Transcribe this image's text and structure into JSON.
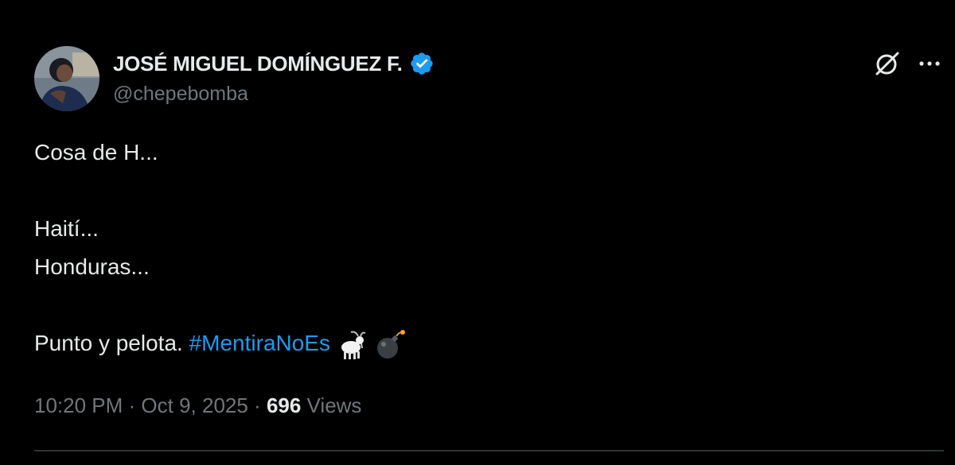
{
  "author": {
    "display_name": "JOSÉ MIGUEL DOMÍNGUEZ F.",
    "handle": "@chepebomba",
    "verified_icon": "verified-badge-icon",
    "verified_color": "#1d9bf0"
  },
  "header_actions": {
    "grok_icon": "grok-icon",
    "more_icon": "more-options-icon"
  },
  "tweet": {
    "line1": "Cosa de H...",
    "line2": "Haití...",
    "line3": "Honduras...",
    "line4_text": "Punto y pelota. ",
    "hashtag": "#MentiraNoEs",
    "emojis": [
      "goat-emoji",
      "bomb-emoji"
    ]
  },
  "meta": {
    "time": "10:20 PM",
    "separator1": " · ",
    "date": "Oct 9, 2025",
    "separator2": " · ",
    "views_count": "696",
    "views_label": " Views"
  },
  "colors": {
    "background": "#000000",
    "text_primary": "#e7e9ea",
    "text_secondary": "#71767b",
    "accent": "#1d9bf0",
    "divider": "#2f3336"
  }
}
